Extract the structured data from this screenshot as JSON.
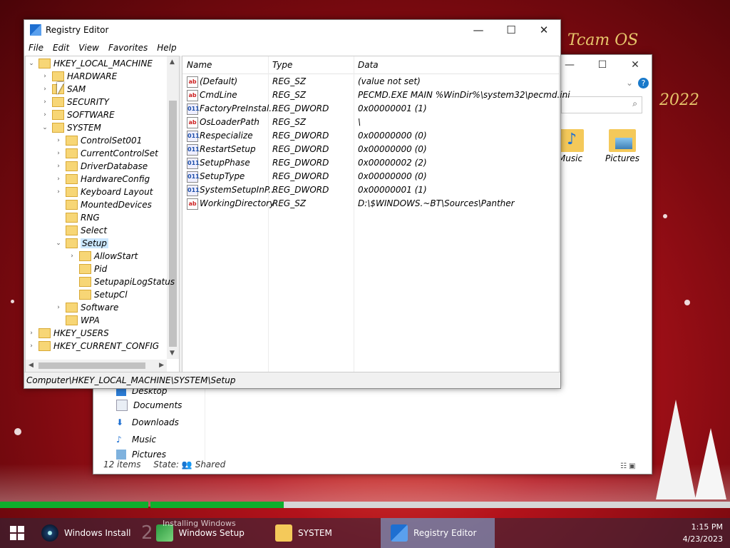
{
  "wallpaper": {
    "text_top": "Tcam OS",
    "text_year": "2022"
  },
  "explorer": {
    "icons": [
      {
        "label": "Music"
      },
      {
        "label": "Pictures"
      }
    ],
    "nav": [
      "Desktop",
      "Documents",
      "Downloads",
      "Music",
      "Pictures"
    ],
    "status_items": "12 items",
    "status_state_label": "State:",
    "status_state_value": "Shared"
  },
  "regedit": {
    "title": "Registry Editor",
    "menu": [
      "File",
      "Edit",
      "View",
      "Favorites",
      "Help"
    ],
    "tree": [
      {
        "label": "HKEY_LOCAL_MACHINE",
        "level": 0,
        "exp": "v"
      },
      {
        "label": "HARDWARE",
        "level": 1,
        "exp": ">"
      },
      {
        "label": "SAM",
        "level": 1,
        "exp": ">"
      },
      {
        "label": "SECURITY",
        "level": 1,
        "exp": ">"
      },
      {
        "label": "SOFTWARE",
        "level": 1,
        "exp": ">"
      },
      {
        "label": "SYSTEM",
        "level": 1,
        "exp": "v"
      },
      {
        "label": "ControlSet001",
        "level": 2,
        "exp": ">"
      },
      {
        "label": "CurrentControlSet",
        "level": 2,
        "exp": ">"
      },
      {
        "label": "DriverDatabase",
        "level": 2,
        "exp": ">"
      },
      {
        "label": "HardwareConfig",
        "level": 2,
        "exp": ">"
      },
      {
        "label": "Keyboard Layout",
        "level": 2,
        "exp": ">"
      },
      {
        "label": "MountedDevices",
        "level": 2,
        "exp": ""
      },
      {
        "label": "RNG",
        "level": 2,
        "exp": ""
      },
      {
        "label": "Select",
        "level": 2,
        "exp": ""
      },
      {
        "label": "Setup",
        "level": 2,
        "exp": "v",
        "selected": true
      },
      {
        "label": "AllowStart",
        "level": 3,
        "exp": ">"
      },
      {
        "label": "Pid",
        "level": 3,
        "exp": ""
      },
      {
        "label": "SetupapiLogStatus",
        "level": 3,
        "exp": ""
      },
      {
        "label": "SetupCl",
        "level": 3,
        "exp": ""
      },
      {
        "label": "Software",
        "level": 2,
        "exp": ">"
      },
      {
        "label": "WPA",
        "level": 2,
        "exp": ""
      },
      {
        "label": "HKEY_USERS",
        "level": 0,
        "exp": ">"
      },
      {
        "label": "HKEY_CURRENT_CONFIG",
        "level": 0,
        "exp": ">"
      }
    ],
    "columns": [
      "Name",
      "Type",
      "Data"
    ],
    "values": [
      {
        "name": "(Default)",
        "type": "REG_SZ",
        "data": "(value not set)",
        "icon": "sz"
      },
      {
        "name": "CmdLine",
        "type": "REG_SZ",
        "data": "PECMD.EXE MAIN %WinDir%\\system32\\pecmd.ini",
        "icon": "sz"
      },
      {
        "name": "FactoryPreInstal...",
        "type": "REG_DWORD",
        "data": "0x00000001 (1)",
        "icon": "dw"
      },
      {
        "name": "OsLoaderPath",
        "type": "REG_SZ",
        "data": "\\",
        "icon": "sz"
      },
      {
        "name": "Respecialize",
        "type": "REG_DWORD",
        "data": "0x00000000 (0)",
        "icon": "dw"
      },
      {
        "name": "RestartSetup",
        "type": "REG_DWORD",
        "data": "0x00000000 (0)",
        "icon": "dw"
      },
      {
        "name": "SetupPhase",
        "type": "REG_DWORD",
        "data": "0x00000002 (2)",
        "icon": "dw"
      },
      {
        "name": "SetupType",
        "type": "REG_DWORD",
        "data": "0x00000000 (0)",
        "icon": "dw"
      },
      {
        "name": "SystemSetupInP...",
        "type": "REG_DWORD",
        "data": "0x00000001 (1)",
        "icon": "dw"
      },
      {
        "name": "WorkingDirectory",
        "type": "REG_SZ",
        "data": "D:\\$WINDOWS.~BT\\Sources\\Panther",
        "icon": "sz"
      }
    ],
    "status_path": "Computer\\HKEY_LOCAL_MACHINE\\SYSTEM\\Setup"
  },
  "progress": [
    0.2,
    0.23
  ],
  "taskbar": {
    "items": [
      {
        "label": "Windows Install"
      },
      {
        "label": "Windows Setup",
        "overlay": "Installing Windows"
      },
      {
        "label": "SYSTEM"
      },
      {
        "label": "Registry Editor",
        "active": true
      }
    ],
    "overlay_digit": "2",
    "time": "1:15 PM",
    "date": "4/23/2023"
  },
  "colors": {
    "progress_fill": "#0fae2d",
    "taskbar_active": "#8cb4e6",
    "selection": "#cce8ff"
  }
}
